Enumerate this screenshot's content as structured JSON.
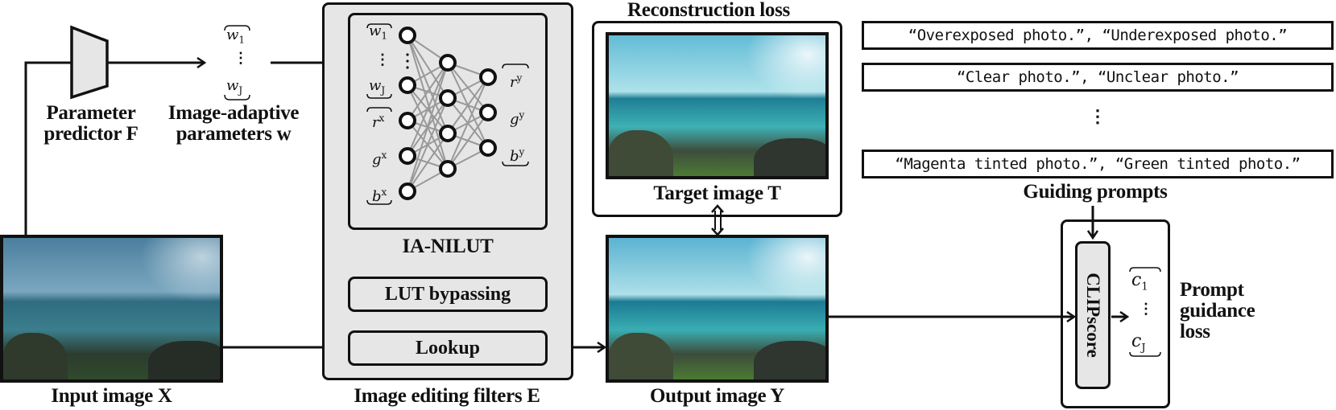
{
  "labels": {
    "parameter_predictor": [
      "Parameter",
      "predictor F"
    ],
    "image_adaptive_params": [
      "Image-adaptive",
      "parameters w"
    ],
    "ia_nilut": "IA-NILUT",
    "lut_bypassing": "LUT bypassing",
    "lookup": "Lookup",
    "image_editing_filters": "Image editing filters E",
    "input_image": "Input image X",
    "output_image": "Output image Y",
    "target_image": "Target image T",
    "reconstruction_loss": "Reconstruction loss",
    "guiding_prompts": "Guiding prompts",
    "clipscore": "CLIPscore",
    "prompt_guidance_loss": [
      "Prompt",
      "guidance",
      "loss"
    ]
  },
  "params": {
    "w_first": "w",
    "w_first_sub": "1",
    "w_last": "w",
    "w_last_sub": "J",
    "vdots": "⋮"
  },
  "network": {
    "inputs": [
      "r",
      "g",
      "b"
    ],
    "input_sup": "x",
    "outputs": [
      "r",
      "g",
      "b"
    ],
    "output_sup": "y",
    "w_first": "w",
    "w_first_sub": "1",
    "w_last": "w",
    "w_last_sub": "J"
  },
  "clip_outputs": {
    "c_first": "c",
    "c_first_sub": "1",
    "c_last": "c",
    "c_last_sub": "J"
  },
  "prompts": [
    "“Overexposed photo.”, “Underexposed photo.”",
    "“Clear photo.”, “Unclear photo.”",
    "“Magenta tinted photo.”, “Green tinted photo.”"
  ],
  "prompts_ellipsis": "⋮",
  "colors": {
    "box_fill": "#e6e6e6",
    "stroke": "#111111",
    "edge_gray": "#999999"
  }
}
